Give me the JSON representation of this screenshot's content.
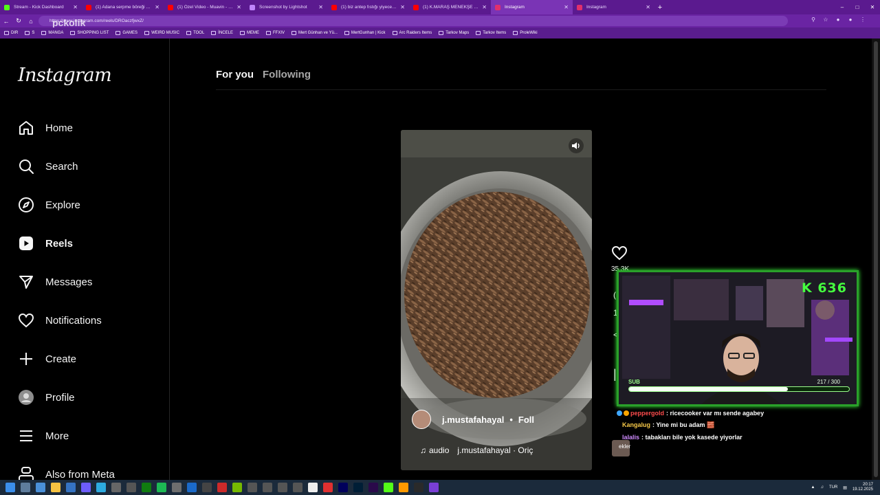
{
  "browser": {
    "tabs": [
      {
        "label": "Stream - Kick Dashboard",
        "color": "#53fc18",
        "active": false
      },
      {
        "label": "(1) Adana serpme böreği #böreğ",
        "color": "#ff0000",
        "active": false
      },
      {
        "label": "(1) Özel Video - Muavin - Dinlenm",
        "color": "#ff0000",
        "active": false
      },
      {
        "label": "Screenshot by Lightshot",
        "color": "#c084fc",
        "active": false
      },
      {
        "label": "(1) biz antep fıstığı yiyecek adam",
        "color": "#ff0000",
        "active": false
      },
      {
        "label": "(1) K.MARAŞ MENEKŞE PAÇA ÇORBA",
        "color": "#ff0000",
        "active": false
      },
      {
        "label": "Instagram",
        "color": "#e1306c",
        "active": true
      },
      {
        "label": "Instagram",
        "color": "#e1306c",
        "active": false
      }
    ],
    "new_tab": "+",
    "url": "https://www.instagram.com/reels/DROaczfjwxZ/",
    "watermark": "pckolik",
    "bookmarks": [
      "DIR",
      "S",
      "MANGA",
      "SHOPPING LIST",
      "GAMES",
      "WEIRD MUSIC",
      "TOOL",
      "İNCELE",
      "MEME",
      "FFXIV",
      "Mert Günhan ve Yü...",
      "MertGunhan | Kick",
      "Arc Raiders Items",
      "Tarkov Maps",
      "Tarkov Items",
      "ProleWiki"
    ]
  },
  "sidebar": {
    "logo": "Instagram",
    "items": [
      {
        "label": "Home",
        "icon": "home-icon"
      },
      {
        "label": "Search",
        "icon": "search-icon"
      },
      {
        "label": "Explore",
        "icon": "compass-icon"
      },
      {
        "label": "Reels",
        "icon": "reels-icon"
      },
      {
        "label": "Messages",
        "icon": "send-icon"
      },
      {
        "label": "Notifications",
        "icon": "heart-icon"
      },
      {
        "label": "Create",
        "icon": "plus-icon"
      },
      {
        "label": "Profile",
        "icon": "profile-icon"
      },
      {
        "label": "More",
        "icon": "menu-icon"
      },
      {
        "label": "Also from Meta",
        "icon": "meta-icon"
      }
    ]
  },
  "feed": {
    "tab_for_you": "For you",
    "tab_following": "Following"
  },
  "reel": {
    "username": "j.mustafahayal",
    "separator": "•",
    "follow": "Foll",
    "audio_prefix": "audio",
    "audio_text": "j.mustafahayal · Oriç",
    "like_count": "35.3K",
    "comment_count": "1"
  },
  "stream": {
    "kick_count": "636",
    "sub_label": "SUB",
    "sub_current": 217,
    "sub_goal": 300,
    "sub_text": "217 / 300"
  },
  "chat": [
    {
      "user": "peppergold",
      "color": "#ff4d4d",
      "message": ": ricecooker var mı sende agabey"
    },
    {
      "user": "Kangalug",
      "color": "#f7c948",
      "message": ": Yine mi bu adam 🧱"
    },
    {
      "user": "lalalis",
      "color": "#d08cff",
      "message": ": tabakları bile yok kasede yiyorlar"
    }
  ],
  "chat_avatar_text": "ekler",
  "tray": {
    "lang": "TUR",
    "time": "20:17",
    "date": "19.12.2025"
  }
}
